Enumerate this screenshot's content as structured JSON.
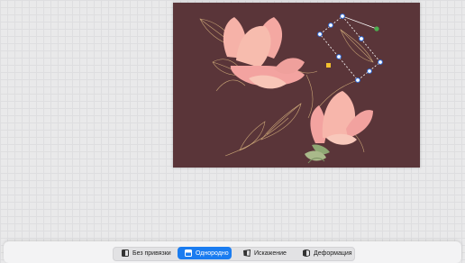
{
  "toolbar": {
    "modes": [
      {
        "label": "Без привязки",
        "icon": "free-transform-icon",
        "active": false
      },
      {
        "label": "Однородно",
        "icon": "uniform-transform-icon",
        "active": true
      },
      {
        "label": "Искажение",
        "icon": "distort-icon",
        "active": false
      },
      {
        "label": "Деформация",
        "icon": "warp-icon",
        "active": false
      }
    ]
  },
  "colors": {
    "canvas_background": "#5a3539",
    "accent": "#1a7cf0",
    "flower_pink": "#f3a3a0",
    "line_gold": "#c9a476",
    "handle_blue": "#2f6fe0",
    "rotation_handle": "#4caf50",
    "anchor_handle": "#f2c12e"
  }
}
